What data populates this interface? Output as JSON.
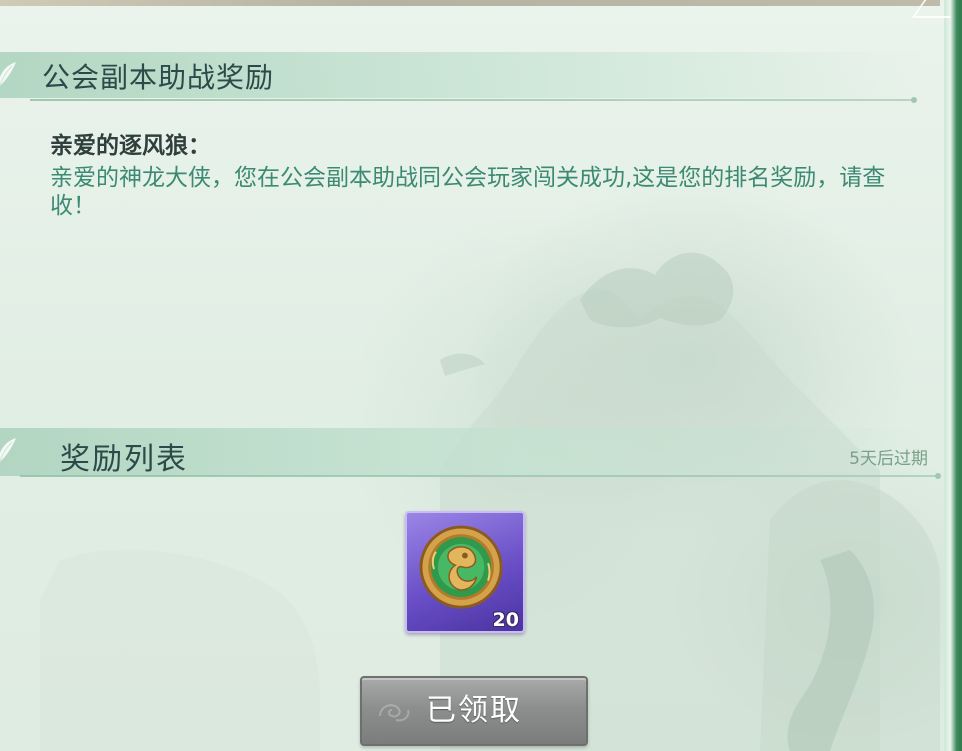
{
  "mail": {
    "title": "公会副本助战奖励",
    "greeting": "亲爱的逐风狼：",
    "body": "亲爱的神龙大侠，您在公会副本助战同公会玩家闯关成功,这是您的排名奖励，请查收！"
  },
  "rewards": {
    "header": "奖励列表",
    "expire_text": "5天后过期",
    "items": [
      {
        "icon": "jade-dragon-medallion-icon",
        "count": "20"
      }
    ]
  },
  "claim_button": {
    "label": "已领取"
  },
  "colors": {
    "title": "#2c4a4a",
    "body_text": "#3c8a73",
    "item_frame": "#6a4fc7",
    "button_disabled": "#8d8f8e"
  }
}
